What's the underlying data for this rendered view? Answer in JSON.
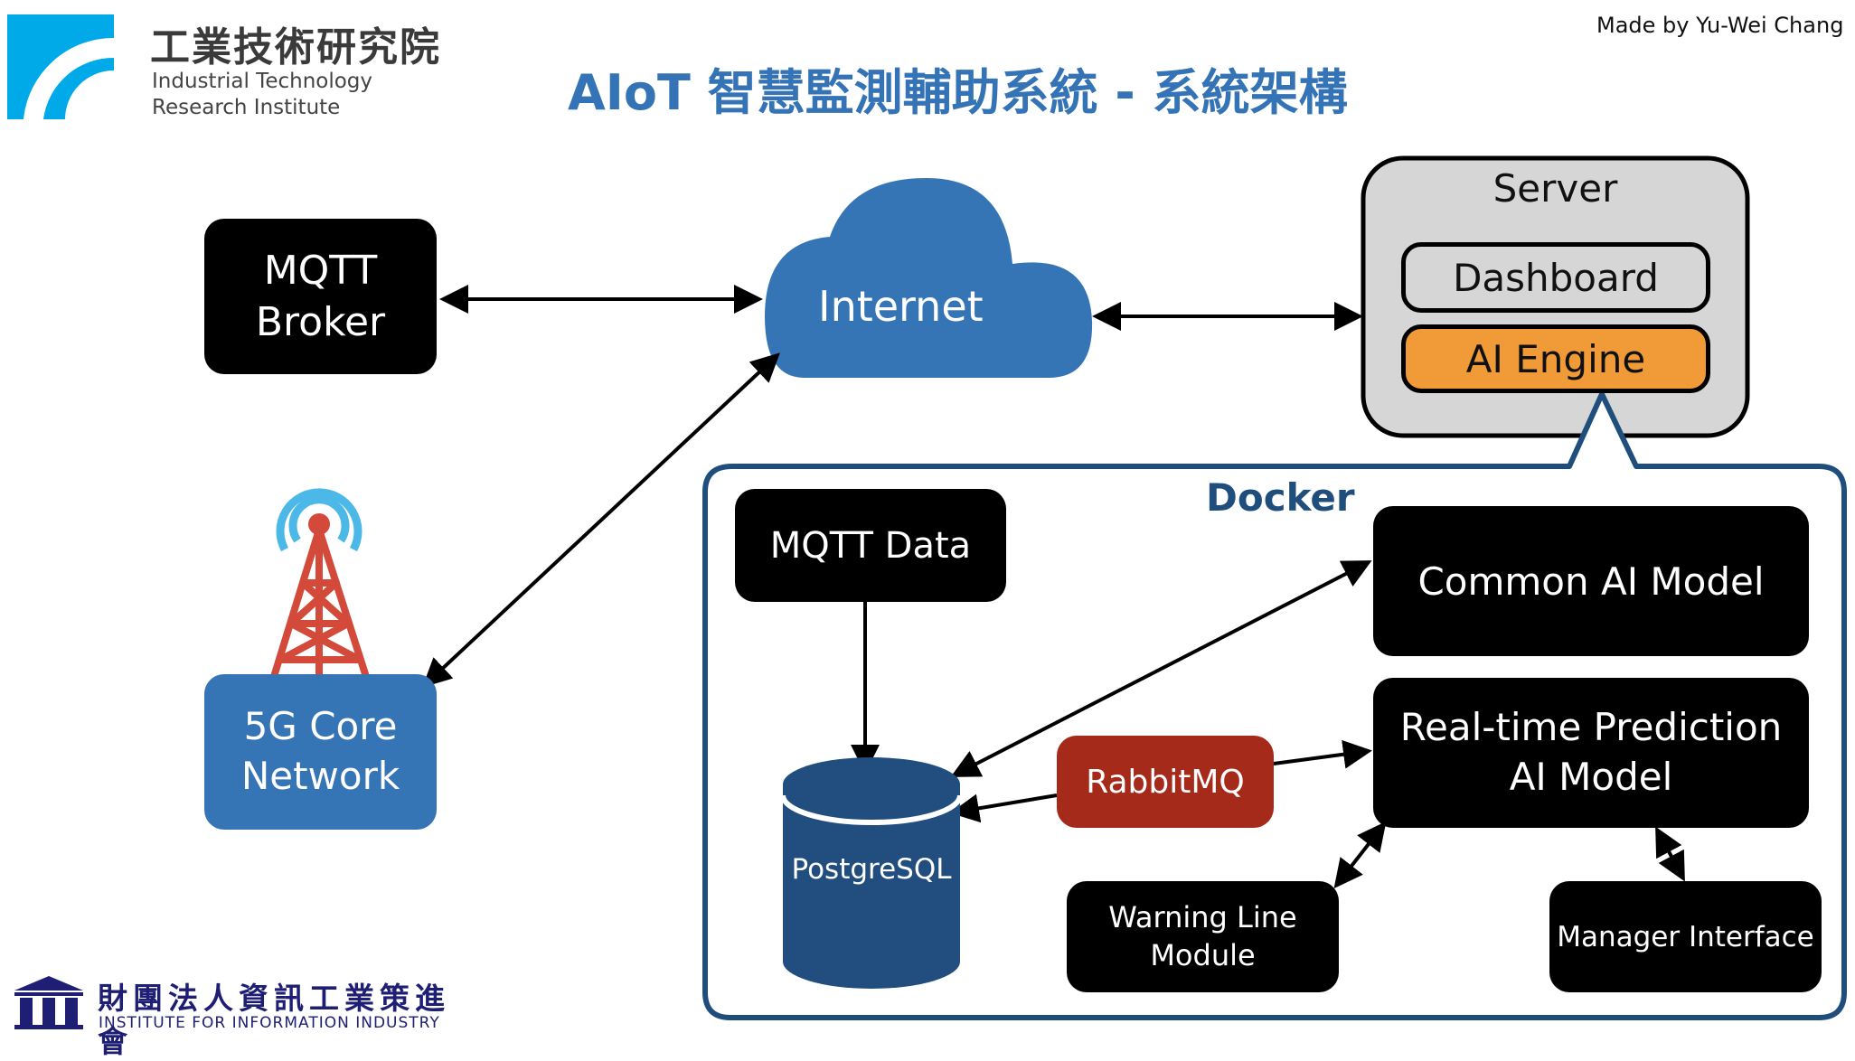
{
  "header": {
    "title": "AIoT 智慧監測輔助系統 - 系統架構",
    "credit": "Made by Yu-Wei Chang",
    "itri_logo": {
      "name_cn": "工業技術研究院",
      "name_en_line1": "Industrial Technology",
      "name_en_line2": "Research Institute",
      "icon": "itri-logo-icon"
    }
  },
  "footer": {
    "iii_logo": {
      "name_cn": "財團法人資訊工業策進會",
      "name_en": "INSTITUTE FOR INFORMATION INDUSTRY",
      "icon": "iii-temple-logo-icon"
    }
  },
  "nodes": {
    "mqtt_broker": "MQTT\nBroker",
    "internet": "Internet",
    "server": {
      "title": "Server",
      "dashboard": "Dashboard",
      "ai_engine": "AI Engine"
    },
    "core_5g": "5G Core\nNetwork",
    "tower_icon": "cell-tower-icon",
    "docker": {
      "title": "Docker",
      "mqtt_data": "MQTT Data",
      "postgresql": "PostgreSQL",
      "rabbitmq": "RabbitMQ",
      "common_ai": "Common AI Model",
      "realtime_ai": "Real-time Prediction\nAI Model",
      "warning_line": "Warning Line\nModule",
      "manager_interface": "Manager Interface"
    }
  },
  "connections": [
    {
      "from": "MQTT Broker",
      "to": "Internet",
      "type": "bidirectional"
    },
    {
      "from": "Internet",
      "to": "Server",
      "type": "bidirectional"
    },
    {
      "from": "Internet",
      "to": "5G Core Network",
      "type": "bidirectional"
    },
    {
      "from": "MQTT Data",
      "to": "PostgreSQL",
      "type": "directed"
    },
    {
      "from": "PostgreSQL",
      "to": "Common AI Model",
      "type": "bidirectional"
    },
    {
      "from": "RabbitMQ",
      "to": "PostgreSQL",
      "type": "directed"
    },
    {
      "from": "RabbitMQ",
      "to": "Real-time Prediction AI Model",
      "type": "directed"
    },
    {
      "from": "Real-time Prediction AI Model",
      "to": "Warning Line Module",
      "type": "bidirectional"
    },
    {
      "from": "Real-time Prediction AI Model",
      "to": "Manager Interface",
      "type": "bidirectional"
    },
    {
      "from": "Docker",
      "to": "AI Engine",
      "type": "callout"
    }
  ],
  "colors": {
    "title_blue": "#3473b5",
    "cloud_blue": "#3574b5",
    "core_blue": "#3574b5",
    "docker_navy": "#1f4e7d",
    "db_navy": "#214e7e",
    "rabbit_red": "#a52a19",
    "ai_engine_orange": "#f09b38",
    "server_gray": "#d6d6d6",
    "tower_red": "#d44a3a",
    "signal_cyan": "#4cb8e8",
    "itri_cyan": "#00a9e8",
    "iii_navy": "#1d1e74"
  }
}
